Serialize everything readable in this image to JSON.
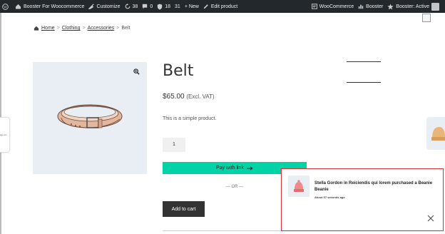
{
  "admin_bar": {
    "site_name": "Booster For Woocommerce",
    "customize": "Customize",
    "updates_count": "38",
    "comments_count": "0",
    "security_count_1": "18",
    "security_count_2": "31",
    "new_label": "+ New",
    "edit_product": "Edit product",
    "woocommerce": "WooCommerce",
    "booster": "Booster",
    "booster_status": "Booster: Active"
  },
  "breadcrumb": {
    "home": "Home",
    "clothing": "Clothing",
    "accessories": "Accessories",
    "current": "Belt",
    "separator": ">"
  },
  "product": {
    "title": "Belt",
    "price": "$65.00",
    "price_suffix": "(Excl. VAT)",
    "description": "This is a simple product.",
    "quantity": "1",
    "pay_button": "Pay with link",
    "or_label": "— OR —",
    "add_to_cart": "Add to cart"
  },
  "left_tab": {
    "text": "age ion"
  },
  "notification": {
    "message": "Stella Gordon in Reiciendis qui lorem purchased a Beanie Beanie",
    "time": "About 57 seconds ago"
  },
  "colors": {
    "admin_bar_bg": "#23282d",
    "pay_button_bg": "#00d4a6",
    "add_to_cart_bg": "#333333",
    "notification_border": "#d9323a"
  }
}
